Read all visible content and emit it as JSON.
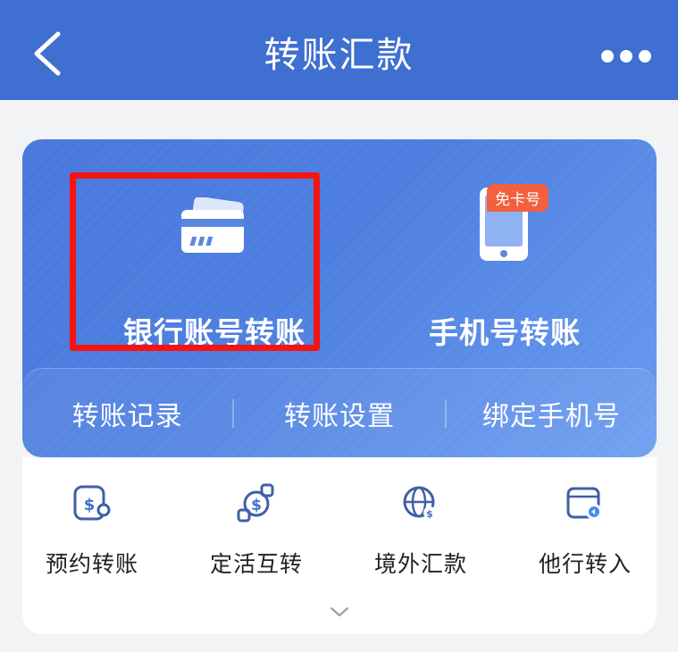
{
  "header": {
    "title": "转账汇款"
  },
  "main_card": {
    "bank_transfer_label": "银行账号转账",
    "phone_transfer_label": "手机号转账",
    "phone_badge": "免卡号"
  },
  "card_links": {
    "records": "转账记录",
    "settings": "转账设置",
    "bind_phone": "绑定手机号"
  },
  "quick_actions": [
    {
      "label": "预约转账",
      "icon": "scheduled-transfer-icon"
    },
    {
      "label": "定活互转",
      "icon": "deposit-exchange-icon"
    },
    {
      "label": "境外汇款",
      "icon": "overseas-remittance-icon"
    },
    {
      "label": "他行转入",
      "icon": "other-bank-transfer-in-icon"
    }
  ],
  "colors": {
    "header_bg": "#3f6fd0",
    "card_bg": "#4d7fe0",
    "highlight": "#f41414",
    "badge": "#f2603e",
    "icon_stroke": "#3f5fa6"
  }
}
